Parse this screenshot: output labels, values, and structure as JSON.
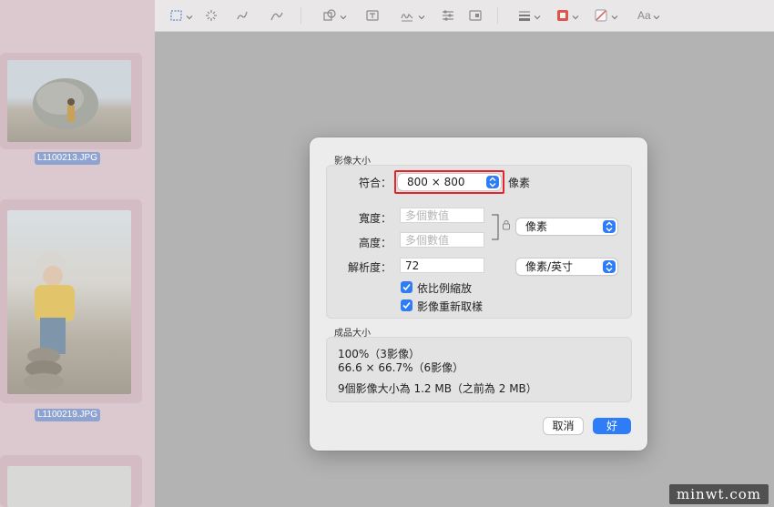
{
  "sidebar": {
    "items": [
      {
        "filename": "L1100213.JPG"
      },
      {
        "filename": "L1100219.JPG"
      }
    ]
  },
  "toolbar": {
    "icons": [
      "selection-icon",
      "instant-alpha-icon",
      "sketch-icon",
      "draw-icon",
      "shapes-icon",
      "text-icon",
      "adjust-color-icon",
      "adjust-size-icon",
      "border-style-icon",
      "border-color-icon",
      "fill-color-icon"
    ],
    "text_style_label": "Aa"
  },
  "dialog": {
    "image_size_title": "影像大小",
    "fit_label": "符合：",
    "fit_value": "800 × 800",
    "fit_unit": "像素",
    "width_label": "寬度：",
    "width_placeholder": "多個數值",
    "height_label": "高度：",
    "height_placeholder": "多個數值",
    "size_unit": "像素",
    "resolution_label": "解析度：",
    "resolution_value": "72",
    "resolution_unit": "像素/英寸",
    "scale_proportionally": "依比例縮放",
    "resample_image": "影像重新取樣",
    "resulting_size_title": "成品大小",
    "result_percent": "100%（3影像）",
    "result_dims": "66.6 × 66.7%（6影像）",
    "result_summary": "9個影像大小為 1.2 MB（之前為 2 MB）",
    "cancel_label": "取消",
    "ok_label": "好"
  },
  "watermark": "minwt.com",
  "colors": {
    "accent": "#2f7df6",
    "highlight": "#e3252b",
    "sidebar_bg": "#dcc9cf"
  }
}
